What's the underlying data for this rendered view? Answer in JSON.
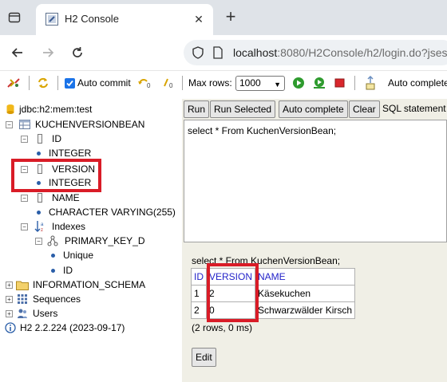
{
  "browser": {
    "tab_title": "H2 Console",
    "url_host": "localhost",
    "url_rest": ":8080/H2Console/h2/login.do?jsess"
  },
  "toolbar": {
    "auto_commit_label": "Auto commit",
    "auto_commit_checked": true,
    "max_rows_label": "Max rows:",
    "max_rows_value": "1000",
    "auto_complete_label": "Auto complete"
  },
  "tree": {
    "connection": "jdbc:h2:mem:test",
    "table": "KUCHENVERSIONBEAN",
    "col_id": "ID",
    "col_id_type": "INTEGER",
    "col_version": "VERSION",
    "col_version_type": "INTEGER",
    "col_name": "NAME",
    "col_name_type": "CHARACTER VARYING(255)",
    "indexes": "Indexes",
    "pk": "PRIMARY_KEY_D",
    "unique": "Unique",
    "pk_col": "ID",
    "info_schema": "INFORMATION_SCHEMA",
    "sequences": "Sequences",
    "users": "Users",
    "version_info": "H2 2.2.224 (2023-09-17)"
  },
  "query_buttons": {
    "run": "Run",
    "run_selected": "Run Selected",
    "auto_complete": "Auto complete",
    "clear": "Clear",
    "sql_label": "SQL statement"
  },
  "sql": "select * From KuchenVersionBean;",
  "result": {
    "query": "select * From KuchenVersionBean;",
    "headers": [
      "ID",
      "VERSION",
      "NAME"
    ],
    "rows": [
      [
        "1",
        "2",
        "Käsekuchen"
      ],
      [
        "2",
        "0",
        "Schwarzwälder Kirsch"
      ]
    ],
    "rowcount": "(2 rows, 0 ms)",
    "edit": "Edit"
  },
  "colors": {
    "highlight": "#d91c27",
    "header_link": "#2323c9",
    "result_bg": "#f0efe6"
  }
}
